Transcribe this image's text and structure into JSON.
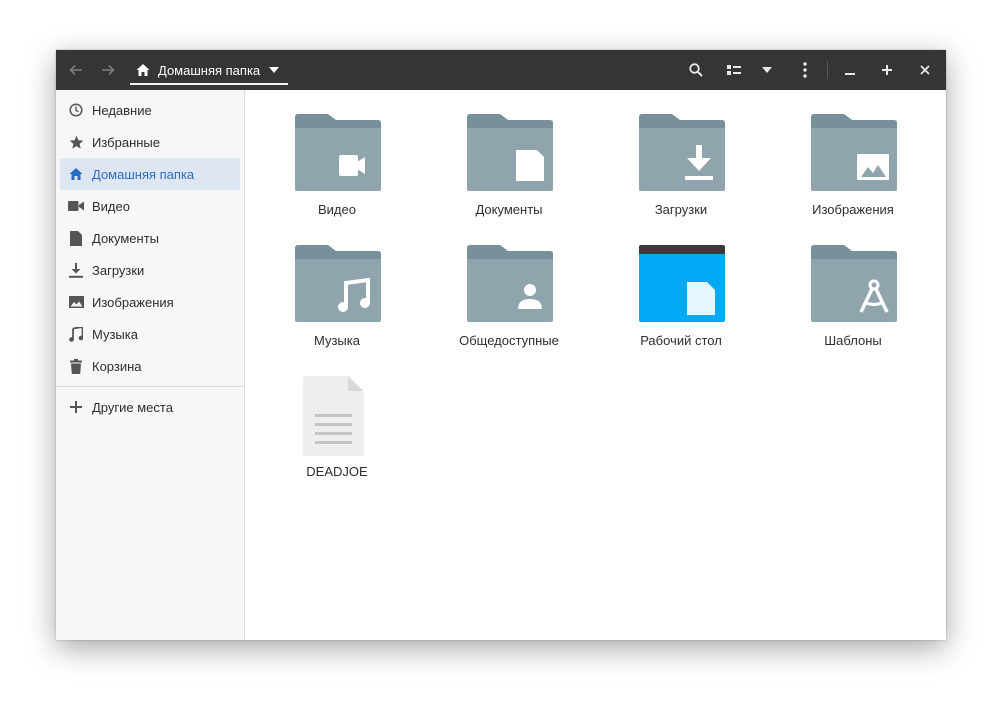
{
  "header": {
    "path_label": "Домашняя папка"
  },
  "sidebar": {
    "items": [
      {
        "label": "Недавние",
        "icon": "clock-icon"
      },
      {
        "label": "Избранные",
        "icon": "star-icon"
      },
      {
        "label": "Домашняя папка",
        "icon": "home-icon",
        "active": true
      },
      {
        "label": "Видео",
        "icon": "video-camera-icon"
      },
      {
        "label": "Документы",
        "icon": "document-icon"
      },
      {
        "label": "Загрузки",
        "icon": "download-icon"
      },
      {
        "label": "Изображения",
        "icon": "image-icon"
      },
      {
        "label": "Музыка",
        "icon": "music-note-icon"
      },
      {
        "label": "Корзина",
        "icon": "trash-icon"
      }
    ],
    "other_places": "Другие места"
  },
  "files": [
    {
      "name": "Видео",
      "icon": "folder-video-icon"
    },
    {
      "name": "Документы",
      "icon": "folder-documents-icon"
    },
    {
      "name": "Загрузки",
      "icon": "folder-downloads-icon"
    },
    {
      "name": "Изображения",
      "icon": "folder-pictures-icon"
    },
    {
      "name": "Музыка",
      "icon": "folder-music-icon"
    },
    {
      "name": "Общедоступные",
      "icon": "folder-public-icon"
    },
    {
      "name": "Рабочий стол",
      "icon": "folder-desktop-icon"
    },
    {
      "name": "Шаблоны",
      "icon": "folder-templates-icon"
    },
    {
      "name": "DEADJOE",
      "icon": "text-file-icon"
    }
  ],
  "colors": {
    "headerbar": "#333537",
    "folder": "#90a4ae",
    "folder_tab": "#78909c",
    "desktop_folder": "#03a9f4",
    "accent": "#2b6cc4"
  }
}
